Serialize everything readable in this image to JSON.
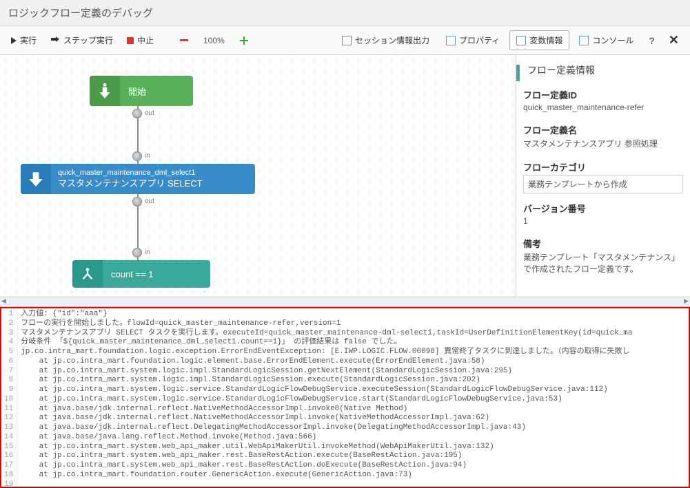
{
  "title": "ロジックフロー定義のデバッグ",
  "toolbar": {
    "run": "実行",
    "step": "ステップ実行",
    "stop": "中止",
    "zoom": "100%",
    "session": "セッション情報出力",
    "property": "プロパティ",
    "variables": "変数情報",
    "console": "コンソール"
  },
  "flow": {
    "start_label": "開始",
    "select_id": "quick_master_maintenance_dml_select1",
    "select_label": "マスタメンテナンスアプリ SELECT",
    "branch_label": "count == 1",
    "port_out": "out",
    "port_in": "in"
  },
  "info": {
    "panel_title": "フロー定義情報",
    "id_label": "フロー定義ID",
    "id_value": "quick_master_maintenance-refer",
    "name_label": "フロー定義名",
    "name_value": "マスタメンテナンスアプリ 参照処理",
    "cat_label": "フローカテゴリ",
    "cat_value": "業務テンプレートから作成",
    "ver_label": "バージョン番号",
    "ver_value": "1",
    "note_label": "備考",
    "note_value": "業務テンプレート「マスタメンテナンス」で作成されたフロー定義です。"
  },
  "log": {
    "lines": [
      "入力値: {\"id\":\"aaa\"}",
      "フローの実行を開始しました。flowId=quick_master_maintenance-refer,version=1",
      "マスタメンテナンスアプリ SELECT タスクを実行します。executeId=quick_master_maintenance-dml-select1,taskId=UserDefinitionElementKey(id=quick_ma",
      "分岐条件 「${quick_master_maintenance_dml_select1.count==1}」 の評価結果は false でした。",
      "jp.co.intra_mart.foundation.logic.exception.ErrorEndEventException: [E.IWP.LOGIC.FLOW.00098] 異常終了タスクに到達しました。（内容の取得に失敗し",
      "    at jp.co.intra_mart.foundation.logic.element.base.ErrorEndElement.execute(ErrorEndElement.java:58)",
      "    at jp.co.intra_mart.system.logic.impl.StandardLogicSession.getNextElement(StandardLogicSession.java:295)",
      "    at jp.co.intra_mart.system.logic.impl.StandardLogicSession.execute(StandardLogicSession.java:202)",
      "    at jp.co.intra_mart.system.logic.service.StandardLogicFlowDebugService.executeSession(StandardLogicFlowDebugService.java:112)",
      "    at jp.co.intra_mart.system.logic.service.StandardLogicFlowDebugService.start(StandardLogicFlowDebugService.java:53)",
      "    at java.base/jdk.internal.reflect.NativeMethodAccessorImpl.invoke0(Native Method)",
      "    at java.base/jdk.internal.reflect.NativeMethodAccessorImpl.invoke(NativeMethodAccessorImpl.java:62)",
      "    at java.base/jdk.internal.reflect.DelegatingMethodAccessorImpl.invoke(DelegatingMethodAccessorImpl.java:43)",
      "    at java.base/java.lang.reflect.Method.invoke(Method.java:566)",
      "    at jp.co.intra_mart.system.web_api_maker.util.WebApiMakerUtil.invokeMethod(WebApiMakerUtil.java:132)",
      "    at jp.co.intra_mart.system.web_api_maker.rest.BaseRestAction.execute(BaseRestAction.java:195)",
      "    at jp.co.intra_mart.system.web_api_maker.rest.BaseRestAction.doExecute(BaseRestAction.java:94)",
      "    at jp.co.intra_mart.foundation.router.GenericAction.execute(GenericAction.java:73)",
      ""
    ]
  }
}
